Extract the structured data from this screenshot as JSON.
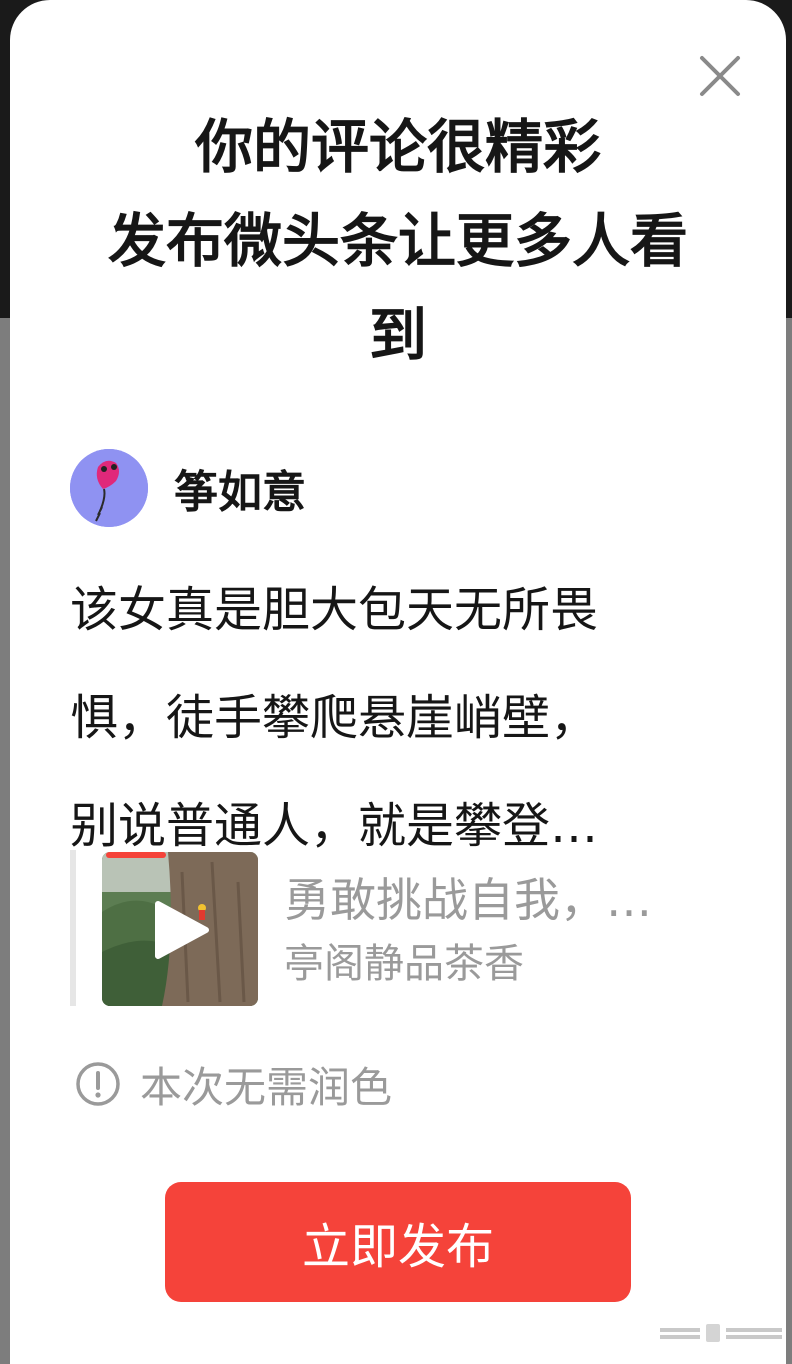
{
  "dialog": {
    "title_lines": [
      "你的评论很精彩",
      "发布微头条让更多人看",
      "到"
    ],
    "author_name": "筝如意",
    "comment_lines": [
      "该女真是胆大包天无所畏",
      "惧，徒手攀爬悬崖峭壁，",
      "别说普通人，就是攀登…"
    ],
    "card": {
      "title": "勇敢挑战自我，…",
      "source": "亭阁静品茶香"
    },
    "notice": "本次无需润色",
    "publish_label": "立即发布"
  },
  "icons": {
    "close": "close-icon",
    "play": "play-icon",
    "info": "info-circle-icon"
  },
  "colors": {
    "accent": "#f5433a",
    "muted_text": "#9a9a9a",
    "text": "#161616"
  }
}
